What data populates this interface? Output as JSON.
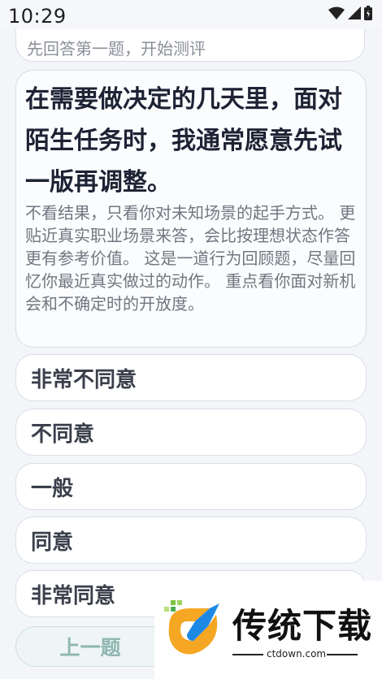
{
  "status_bar": {
    "time": "10:29"
  },
  "prev_card": {
    "text": "先回答第一题，开始测评"
  },
  "question": {
    "title": "在需要做决定的几天里，面对陌生任务时，我通常愿意先试一版再调整。",
    "description": "不看结果，只看你对未知场景的起手方式。 更贴近真实职业场景来答，会比按理想状态作答更有参考价值。 这是一道行为回顾题，尽量回忆你最近真实做过的动作。 重点看你面对新机会和不确定时的开放度。"
  },
  "options": [
    "非常不同意",
    "不同意",
    "一般",
    "同意",
    "非常同意"
  ],
  "nav": {
    "prev_label": "上一题"
  },
  "watermark": {
    "brand": "传统下载",
    "url": "ctdown.com"
  },
  "colors": {
    "accent": "#8fb6b0",
    "card_border": "#d9dee7",
    "logo_orange": "#f5a623",
    "logo_blue": "#1e88e5",
    "logo_green": "#7cc242"
  }
}
